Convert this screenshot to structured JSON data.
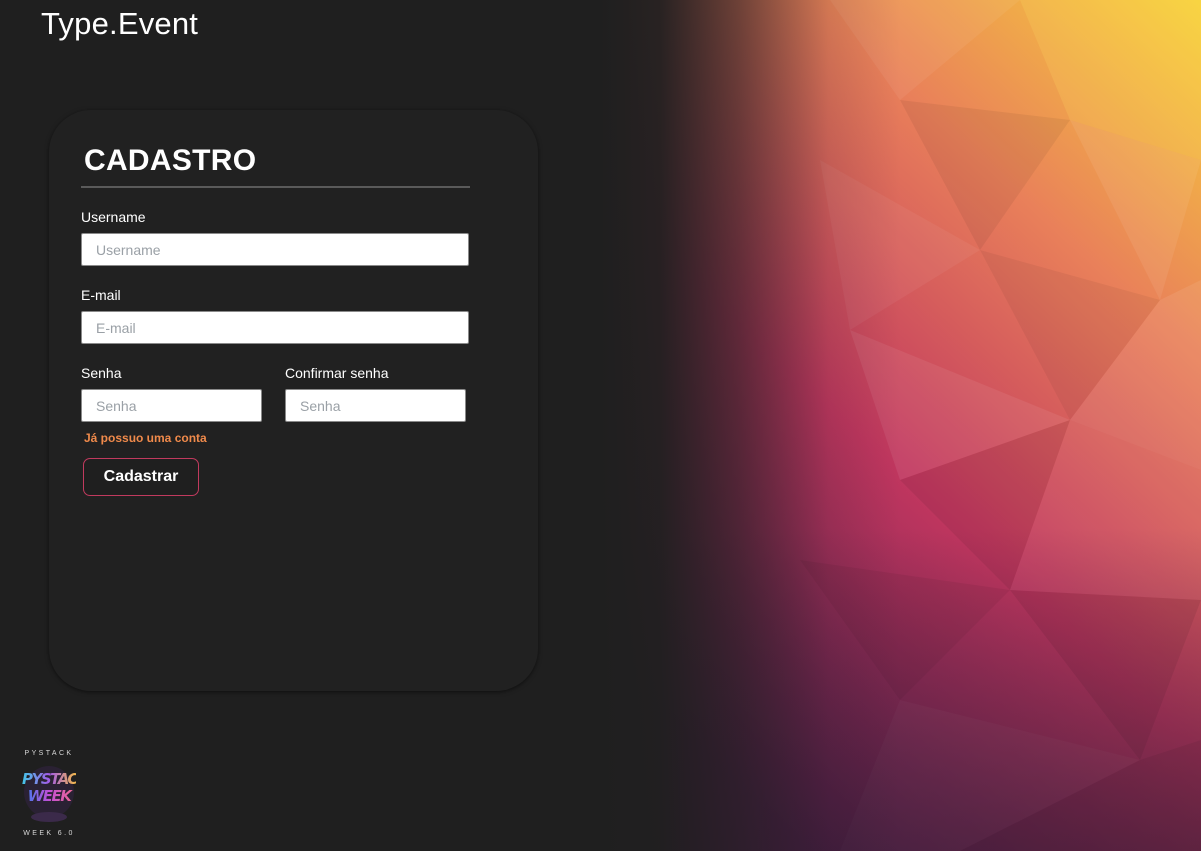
{
  "app": {
    "brand": "Type.Event"
  },
  "form": {
    "title": "CADASTRO",
    "username": {
      "label": "Username",
      "placeholder": "Username",
      "value": ""
    },
    "email": {
      "label": "E-mail",
      "placeholder": "E-mail",
      "value": ""
    },
    "password": {
      "label": "Senha",
      "placeholder": "Senha",
      "value": ""
    },
    "confirm_password": {
      "label": "Confirmar senha",
      "placeholder": "Senha",
      "value": ""
    },
    "login_link": "Já possuo uma conta",
    "submit_label": "Cadastrar"
  },
  "event_logo": {
    "top_text": "PYSTACK",
    "line1": "PYSTACK",
    "line2": "WEEK",
    "bottom_text": "WEEK 6.0"
  },
  "colors": {
    "background": "#1f1f1f",
    "card": "#212121",
    "link": "#f08a4b",
    "button_border": "#c13a5e"
  }
}
